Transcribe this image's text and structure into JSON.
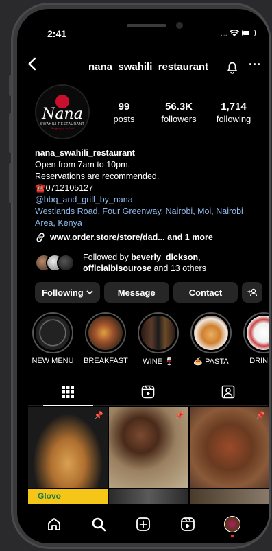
{
  "status_bar": {
    "time": "2:41"
  },
  "header": {
    "handle": "nana_swahili_restaurant",
    "more": "···",
    "back": "<"
  },
  "logo": {
    "name": "Nana",
    "sub": "SWAHILI RESTAURANT",
    "tag": "Bringing joy to food"
  },
  "stats": [
    {
      "value": "99",
      "label": "posts"
    },
    {
      "value": "56.3K",
      "label": "followers"
    },
    {
      "value": "1,714",
      "label": "following"
    }
  ],
  "bio": {
    "name": "nana_swahili_restaurant",
    "line1": "Open from 7am to 10pm.",
    "line2": "Reservations are recommended.",
    "phone": "☎️0712105127",
    "mention": "@bbq_and_grill_by_nana",
    "address": "Westlands Road, Four Greenway, Nairobi, Moi, Nairobi Area, Kenya"
  },
  "website": {
    "url": "www.order.store/store/dad...",
    "more": " and 1 more"
  },
  "followed_by": {
    "prefix": "Followed by ",
    "user1": "beverly_dickson",
    "sep": ",",
    "user2": "officialbisourose",
    "suffix": " and 13 others"
  },
  "actions": {
    "following": "Following",
    "message": "Message",
    "contact": "Contact"
  },
  "highlights": [
    {
      "label": "NEW MENU"
    },
    {
      "label": "BREAKFAST"
    },
    {
      "label": "WINE 🍷"
    },
    {
      "label": "🍝 PASTA"
    },
    {
      "label": "DRINKS"
    }
  ],
  "colors": {
    "link": "#8eb8ea",
    "button_bg": "#262626",
    "brand_red": "#c8102e",
    "notification": "#ff3040"
  },
  "grid_overlay": {
    "brand": "Glovo"
  }
}
